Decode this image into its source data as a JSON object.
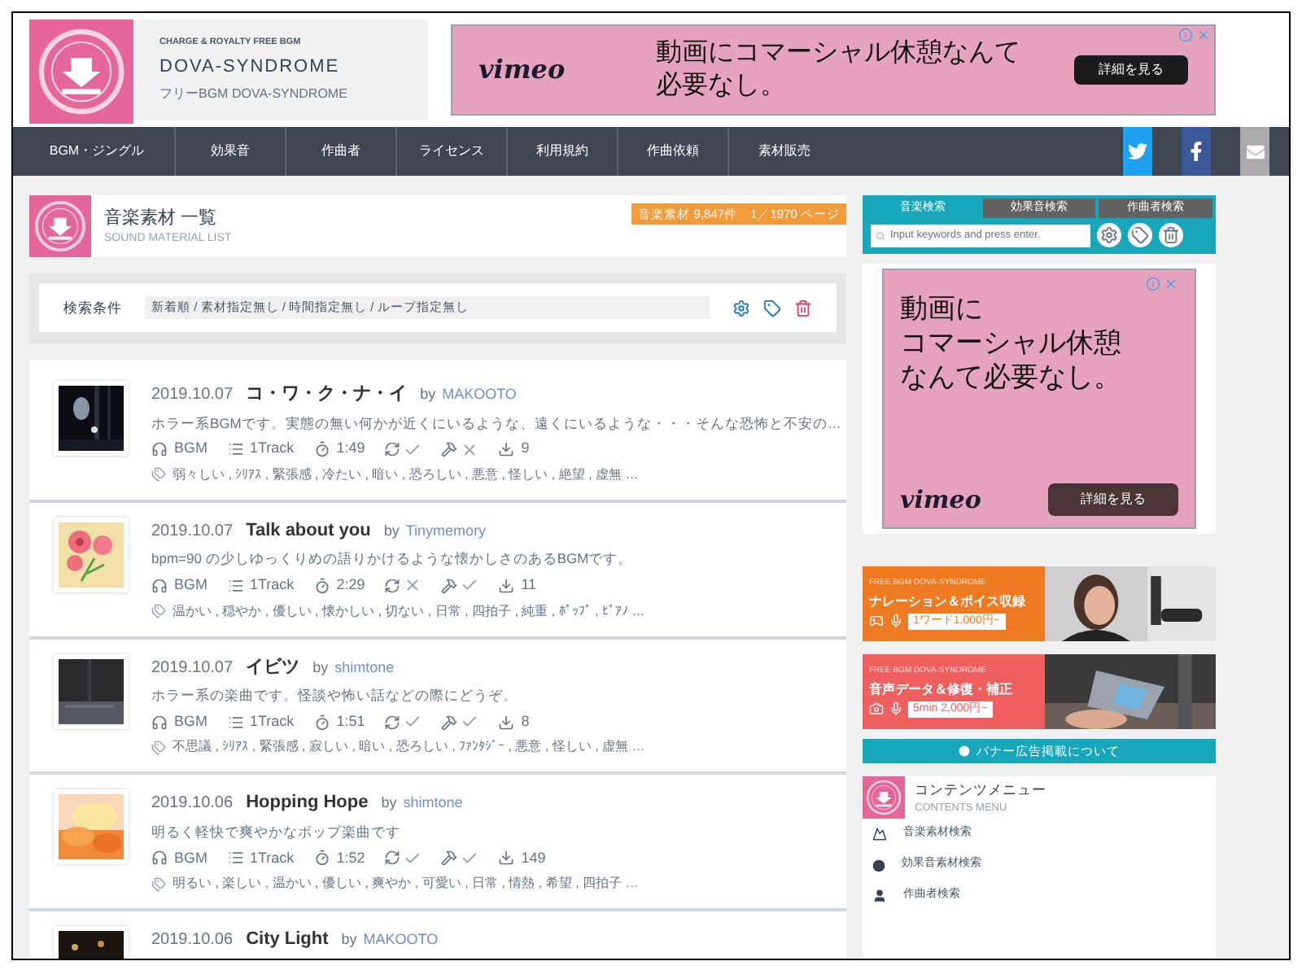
{
  "header": {
    "tagline": "CHARGE & ROYALTY FREE BGM",
    "site_name": "DOVA-SYNDROME",
    "subtitle": "フリーBGM DOVA-SYNDROME"
  },
  "top_ad": {
    "brand": "vimeo",
    "lines": [
      "動画にコマーシャル休憩なんて",
      "必要なし。"
    ],
    "button": "詳細を見る"
  },
  "nav": {
    "items": [
      "BGM・ジングル",
      "効果音",
      "作曲者",
      "ライセンス",
      "利用規約",
      "作曲依頼",
      "素材販売"
    ],
    "social": [
      {
        "kind": "twitter"
      },
      {
        "kind": "facebook"
      },
      {
        "kind": "mail"
      }
    ]
  },
  "list_header": {
    "title": "音楽素材 一覧",
    "subtitle": "SOUND MATERIAL LIST",
    "count_badge": "音楽素材 9,847件　1／1970 ページ"
  },
  "search_conditions": {
    "label": "検索条件",
    "value": "新着順 / 素材指定無し / 時間指定無し / ループ指定無し"
  },
  "tracks": [
    {
      "date": "2019.10.07",
      "title": "コ・ワ・ク・ナ・イ",
      "by": "by",
      "author": "MAKOOTO",
      "description": "ホラー系BGMです。実態の無い何かが近くにいるような、遠くにいるような・・・そんな恐怖と不安の…",
      "genre": "BGM",
      "tracks": "1Track",
      "duration": "1:49",
      "loop": true,
      "editable": false,
      "downloads": "9",
      "tags": "弱々しい , ｼﾘｱｽ , 緊張感 , 冷たい , 暗い , 恐ろしい , 悪意 , 怪しい , 絶望 , 虚無 …"
    },
    {
      "date": "2019.10.07",
      "title": "Talk about you",
      "by": "by",
      "author": "Tinymemory",
      "description": "bpm=90 の少しゆっくりめの語りかけるような懐かしさのあるBGMです。",
      "genre": "BGM",
      "tracks": "1Track",
      "duration": "2:29",
      "loop": false,
      "editable": true,
      "downloads": "11",
      "tags": "温かい , 穏やか , 優しい , 懐かしい , 切ない , 日常 , 四拍子 , 純重 , ﾎﾟｯﾌﾟ , ﾋﾟｱﾉ …"
    },
    {
      "date": "2019.10.07",
      "title": "イビツ",
      "by": "by",
      "author": "shimtone",
      "description": "ホラー系の楽曲です。怪談や怖い話などの際にどうぞ。",
      "genre": "BGM",
      "tracks": "1Track",
      "duration": "1:51",
      "loop": true,
      "editable": true,
      "downloads": "8",
      "tags": "不思議 , ｼﾘｱｽ , 緊張感 , 寂しい , 暗い , 恐ろしい , ﾌｧﾝﾀｼﾞｰ , 悪意 , 怪しい , 虚無 …"
    },
    {
      "date": "2019.10.06",
      "title": "Hopping Hope",
      "by": "by",
      "author": "shimtone",
      "description": "明るく軽快で爽やかなポップ楽曲です",
      "genre": "BGM",
      "tracks": "1Track",
      "duration": "1:52",
      "loop": true,
      "editable": true,
      "downloads": "149",
      "tags": "明るい , 楽しい , 温かい , 優しい , 爽やか , 可愛い , 日常 , 情熱 , 希望 , 四拍子 …"
    },
    {
      "date": "2019.10.06",
      "title": "City Light",
      "by": "by",
      "author": "MAKOOTO"
    }
  ],
  "sidebar": {
    "tabs": [
      {
        "label": "音楽検索",
        "selected": true
      },
      {
        "label": "効果音検索",
        "selected": false
      },
      {
        "label": "作曲者検索",
        "selected": false
      }
    ],
    "search": {
      "placeholder": "Input keywords and press enter."
    },
    "ad": {
      "lines": [
        "動画に",
        "コマーシャル休憩",
        "なんて必要なし。"
      ],
      "brand": "vimeo",
      "button": "詳細を見る"
    },
    "banners": [
      {
        "caption": "FREE BGM DOVA-SYNDROME",
        "title": "ナレーション＆ボイス収録",
        "price": "1ワード1,000円~",
        "color": "#f07a22"
      },
      {
        "caption": "FREE BGM DOVA-SYNDROME",
        "title": "音声データ＆修復・補正",
        "price": "5min 2,000円~",
        "color": "#ef5f60"
      }
    ],
    "banner_info": "バナー広告掲載について",
    "contents_menu": {
      "title": "コンテンツメニュー",
      "subtitle": "CONTENTS MENU",
      "items": [
        {
          "label": "音楽素材検索",
          "kind": "music"
        },
        {
          "label": "効果音素材検索",
          "kind": "sound"
        },
        {
          "label": "作曲者検索",
          "kind": "composer"
        }
      ]
    }
  }
}
